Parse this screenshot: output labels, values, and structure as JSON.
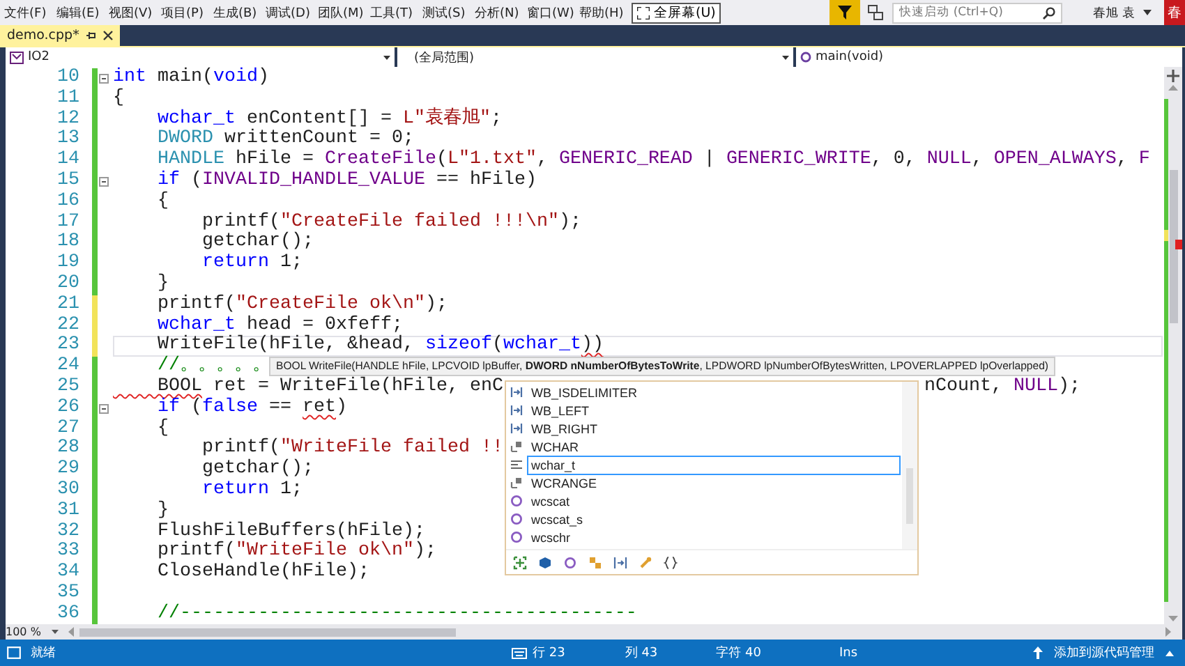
{
  "menu": [
    "文件(F)",
    "编辑(E)",
    "视图(V)",
    "项目(P)",
    "生成(B)",
    "调试(D)",
    "团队(M)",
    "工具(T)",
    "测试(S)",
    "分析(N)",
    "窗口(W)",
    "帮助(H)"
  ],
  "fullscreen_button": "全屏幕(U)",
  "quick_launch": {
    "placeholder": "快速启动 (Ctrl+Q)"
  },
  "user": {
    "name": "春旭 袁",
    "avatar": "春"
  },
  "tabs": [
    {
      "label": "demo.cpp*",
      "selected": true
    }
  ],
  "navigation": {
    "project": "IO2",
    "scope": "(全局范围)",
    "member": "main(void)"
  },
  "lines": [
    {
      "number": "10",
      "saved": true,
      "fold": true,
      "current": false,
      "tokens": [
        {
          "kind": "keyword",
          "text": "int"
        },
        {
          "kind": "plain",
          "text": " main("
        },
        {
          "kind": "keyword",
          "text": "void"
        },
        {
          "kind": "plain",
          "text": ")"
        }
      ]
    },
    {
      "number": "11",
      "saved": true,
      "fold": false,
      "current": false,
      "tokens": [
        {
          "kind": "plain",
          "text": "{"
        }
      ]
    },
    {
      "number": "12",
      "saved": true,
      "fold": false,
      "current": false,
      "tokens": [
        {
          "kind": "keyword",
          "text": "    wchar_t"
        },
        {
          "kind": "plain",
          "text": " enContent[] = "
        },
        {
          "kind": "string",
          "text": "L\"袁春旭\""
        },
        {
          "kind": "plain",
          "text": ";"
        }
      ]
    },
    {
      "number": "13",
      "saved": true,
      "fold": false,
      "current": false,
      "tokens": [
        {
          "kind": "type",
          "text": "    DWORD"
        },
        {
          "kind": "plain",
          "text": " writtenCount = 0;"
        }
      ]
    },
    {
      "number": "14",
      "saved": true,
      "fold": false,
      "current": false,
      "tokens": [
        {
          "kind": "type",
          "text": "    HANDLE"
        },
        {
          "kind": "plain",
          "text": " hFile = "
        },
        {
          "kind": "macro",
          "text": "CreateFile"
        },
        {
          "kind": "plain",
          "text": "("
        },
        {
          "kind": "string",
          "text": "L\"1.txt\""
        },
        {
          "kind": "plain",
          "text": ", "
        },
        {
          "kind": "macro",
          "text": "GENERIC_READ"
        },
        {
          "kind": "plain",
          "text": " | "
        },
        {
          "kind": "macro",
          "text": "GENERIC_WRITE"
        },
        {
          "kind": "plain",
          "text": ", 0, "
        },
        {
          "kind": "macro",
          "text": "NULL"
        },
        {
          "kind": "plain",
          "text": ", "
        },
        {
          "kind": "macro",
          "text": "OPEN_ALWAYS"
        },
        {
          "kind": "plain",
          "text": ", "
        },
        {
          "kind": "macro",
          "text": "F"
        }
      ]
    },
    {
      "number": "15",
      "saved": true,
      "fold": true,
      "current": false,
      "tokens": [
        {
          "kind": "keyword",
          "text": "    if"
        },
        {
          "kind": "plain",
          "text": " ("
        },
        {
          "kind": "macro",
          "text": "INVALID_HANDLE_VALUE"
        },
        {
          "kind": "plain",
          "text": " == hFile)"
        }
      ]
    },
    {
      "number": "16",
      "saved": true,
      "fold": false,
      "current": false,
      "tokens": [
        {
          "kind": "plain",
          "text": "    {"
        }
      ]
    },
    {
      "number": "17",
      "saved": true,
      "fold": false,
      "current": false,
      "tokens": [
        {
          "kind": "plain",
          "text": "        printf("
        },
        {
          "kind": "string",
          "text": "\"CreateFile failed !!!\\n\""
        },
        {
          "kind": "plain",
          "text": ");"
        }
      ]
    },
    {
      "number": "18",
      "saved": true,
      "fold": false,
      "current": false,
      "tokens": [
        {
          "kind": "plain",
          "text": "        getchar();"
        }
      ]
    },
    {
      "number": "19",
      "saved": true,
      "fold": false,
      "current": false,
      "tokens": [
        {
          "kind": "keyword",
          "text": "        return"
        },
        {
          "kind": "plain",
          "text": " 1;"
        }
      ]
    },
    {
      "number": "20",
      "saved": true,
      "fold": false,
      "current": false,
      "tokens": [
        {
          "kind": "plain",
          "text": "    }"
        }
      ]
    },
    {
      "number": "21",
      "saved": false,
      "fold": false,
      "current": false,
      "tokens": [
        {
          "kind": "plain",
          "text": "    printf("
        },
        {
          "kind": "string",
          "text": "\"CreateFile ok\\n\""
        },
        {
          "kind": "plain",
          "text": ");"
        }
      ]
    },
    {
      "number": "22",
      "saved": false,
      "fold": false,
      "current": false,
      "tokens": [
        {
          "kind": "keyword",
          "text": "    wchar_t"
        },
        {
          "kind": "plain",
          "text": " head = 0xfeff;"
        }
      ]
    },
    {
      "number": "23",
      "saved": false,
      "fold": false,
      "current": true,
      "tokens": [
        {
          "kind": "plain",
          "text": "    WriteFile(hFile, &head, "
        },
        {
          "kind": "keyword",
          "text": "sizeof"
        },
        {
          "kind": "plain",
          "text": "("
        },
        {
          "kind": "keyword",
          "text": "wchar_t"
        },
        {
          "kind": "plain",
          "text": "))",
          "squiggle": true
        }
      ]
    },
    {
      "number": "24",
      "saved": true,
      "fold": false,
      "current": false,
      "tokens": [
        {
          "kind": "comment",
          "text": "    //。。。。。"
        }
      ]
    },
    {
      "number": "25",
      "saved": true,
      "fold": false,
      "current": false,
      "tokens": [
        {
          "kind": "plain",
          "text": "    BOOL",
          "squiggle": true
        },
        {
          "kind": "plain",
          "text": " ret = WriteFile(hFile, enC"
        }
      ],
      "tail": [
        {
          "kind": "plain",
          "text": "nCount, "
        },
        {
          "kind": "macro",
          "text": "NULL"
        },
        {
          "kind": "plain",
          "text": ");"
        }
      ]
    },
    {
      "number": "26",
      "saved": true,
      "fold": true,
      "current": false,
      "tokens": [
        {
          "kind": "keyword",
          "text": "    if"
        },
        {
          "kind": "plain",
          "text": " ("
        },
        {
          "kind": "keyword",
          "text": "false"
        },
        {
          "kind": "plain",
          "text": " == "
        },
        {
          "kind": "plain",
          "text": "ret",
          "squiggle": true
        },
        {
          "kind": "plain",
          "text": ")"
        }
      ]
    },
    {
      "number": "27",
      "saved": true,
      "fold": false,
      "current": false,
      "tokens": [
        {
          "kind": "plain",
          "text": "    {"
        }
      ]
    },
    {
      "number": "28",
      "saved": true,
      "fold": false,
      "current": false,
      "tokens": [
        {
          "kind": "plain",
          "text": "        printf("
        },
        {
          "kind": "string",
          "text": "\"WriteFile failed !!"
        }
      ]
    },
    {
      "number": "29",
      "saved": true,
      "fold": false,
      "current": false,
      "tokens": [
        {
          "kind": "plain",
          "text": "        getchar();"
        }
      ]
    },
    {
      "number": "30",
      "saved": true,
      "fold": false,
      "current": false,
      "tokens": [
        {
          "kind": "keyword",
          "text": "        return"
        },
        {
          "kind": "plain",
          "text": " 1;"
        }
      ]
    },
    {
      "number": "31",
      "saved": true,
      "fold": false,
      "current": false,
      "tokens": [
        {
          "kind": "plain",
          "text": "    }"
        }
      ]
    },
    {
      "number": "32",
      "saved": true,
      "fold": false,
      "current": false,
      "tokens": [
        {
          "kind": "plain",
          "text": "    FlushFileBuffers(hFile);"
        }
      ]
    },
    {
      "number": "33",
      "saved": true,
      "fold": false,
      "current": false,
      "tokens": [
        {
          "kind": "plain",
          "text": "    printf("
        },
        {
          "kind": "string",
          "text": "\"WriteFile ok\\n\""
        },
        {
          "kind": "plain",
          "text": ");"
        }
      ]
    },
    {
      "number": "34",
      "saved": true,
      "fold": false,
      "current": false,
      "tokens": [
        {
          "kind": "plain",
          "text": "    CloseHandle(hFile);"
        }
      ]
    },
    {
      "number": "35",
      "saved": true,
      "fold": false,
      "current": false
    },
    {
      "number": "36",
      "saved": true,
      "fold": false,
      "current": false,
      "tokens": [
        {
          "kind": "comment",
          "text": "    //-----------------------------------------"
        }
      ]
    }
  ],
  "signature_tooltip": "BOOL WriteFile(HANDLE hFile, LPCVOID lpBuffer, **DWORD nNumberOfBytesToWrite**, LPDWORD lpNumberOfBytesWritten, LPOVERLAPPED lpOverlapped)",
  "completion": [
    {
      "label": "WB_ISDELIMITER",
      "kind": "enum_member",
      "selected": false
    },
    {
      "label": "WB_LEFT",
      "kind": "enum_member",
      "selected": false
    },
    {
      "label": "WB_RIGHT",
      "kind": "enum_member",
      "selected": false
    },
    {
      "label": "WCHAR",
      "kind": "typedef",
      "selected": false
    },
    {
      "label": "wchar_t",
      "kind": "type",
      "selected": true
    },
    {
      "label": "WCRANGE",
      "kind": "typedef",
      "selected": false
    },
    {
      "label": "wcscat",
      "kind": "function",
      "selected": false
    },
    {
      "label": "wcscat_s",
      "kind": "function",
      "selected": false
    },
    {
      "label": "wcschr",
      "kind": "function",
      "selected": false
    }
  ],
  "zoom": "100 %",
  "status_bar": {
    "ready": "就绪",
    "line": "行 23",
    "column": "列 43",
    "character": "字符 40",
    "mode": "Ins",
    "source_control": "添加到源代码管理"
  }
}
